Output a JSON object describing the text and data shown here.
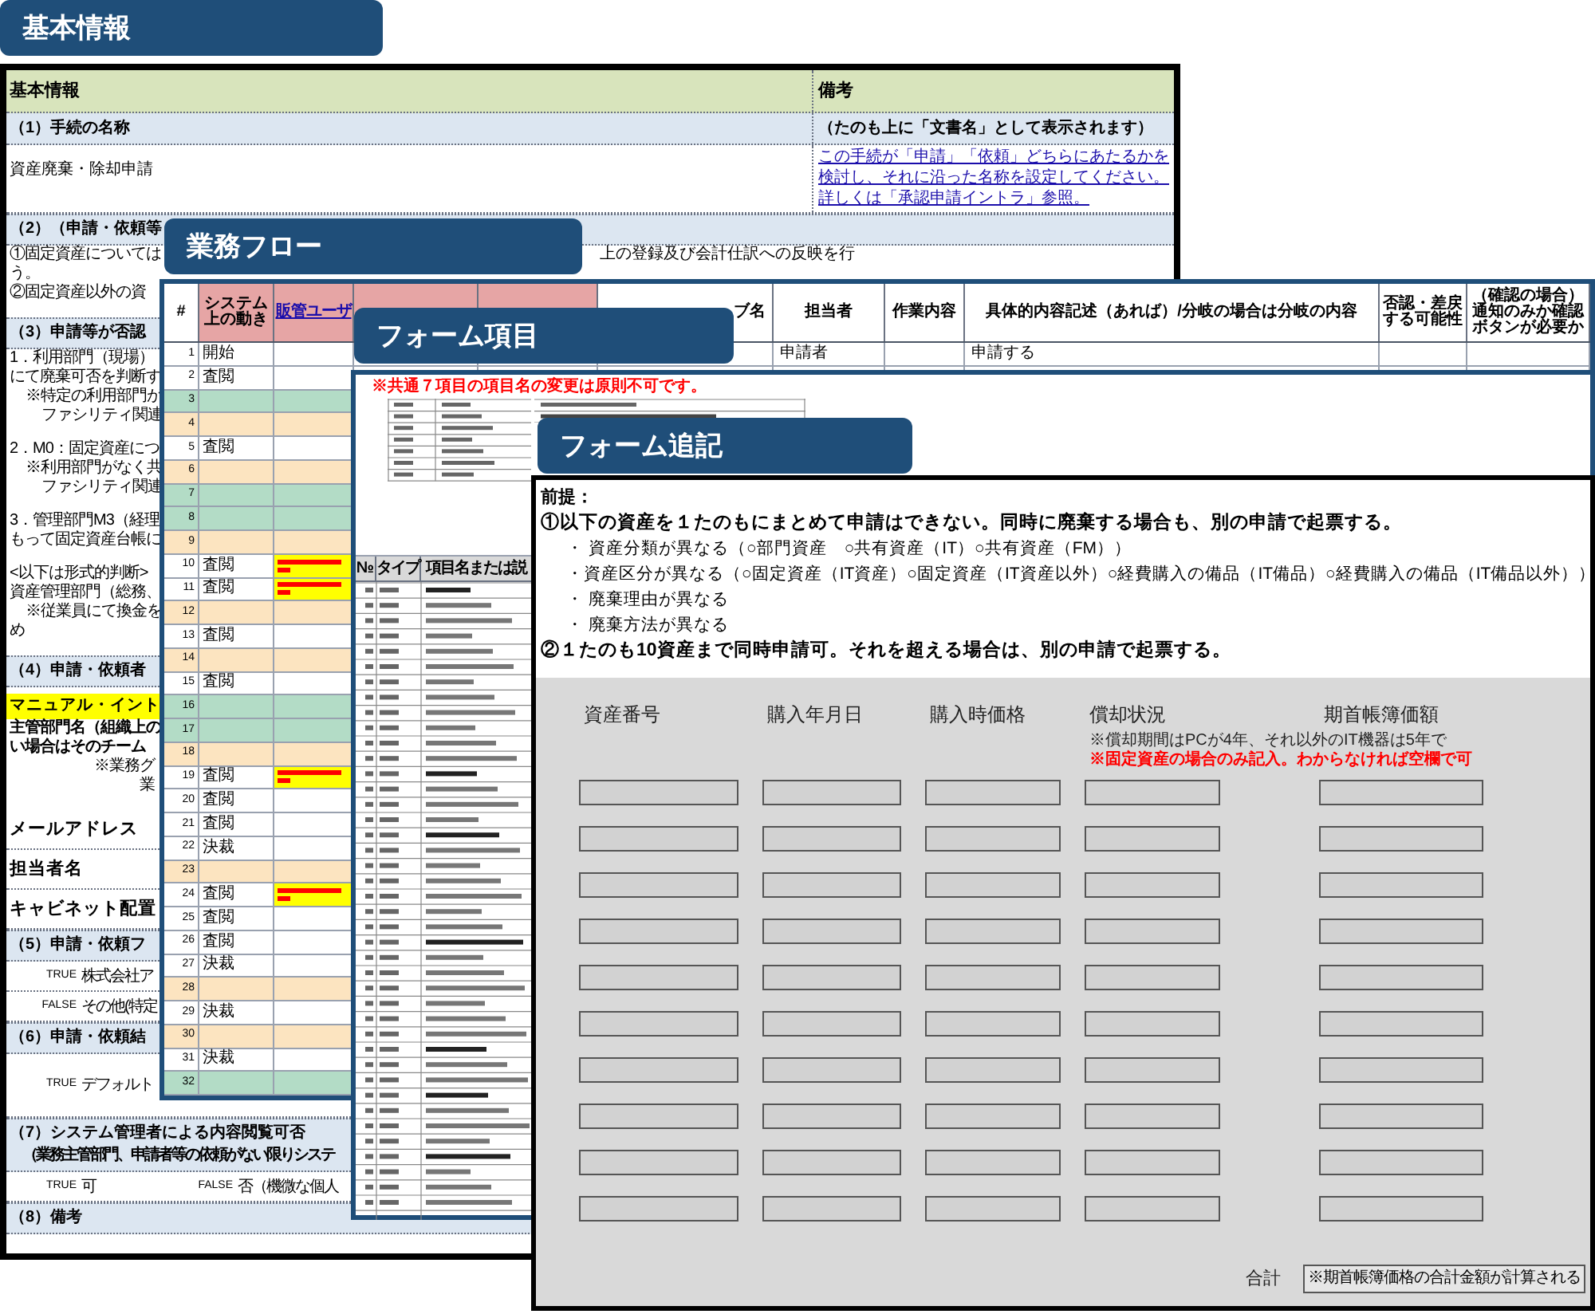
{
  "basic_info": {
    "tab": "基本情報",
    "header": {
      "left": "基本情報",
      "right": "備考"
    },
    "name_section": {
      "title": "（1）手続の名称",
      "note": "（たのも上に「文書名」として表示されます）",
      "value": "資産廃棄・除却申請",
      "help_link": "この手続が「申請」「依頼」どちらにあたるかを検討し、それに沿った名称を設定してください。詳しくは「承認申請イントラ」参照。"
    },
    "blocks": [
      {
        "kind": "band",
        "lines": [
          "（2）（申請・依頼等"
        ]
      },
      {
        "kind": "para",
        "lines": [
          {
            "kind": "plain",
            "text": "①固定資産については",
            "tail": "上の登録及び会計仕訳への反映を行"
          },
          {
            "kind": "plain",
            "text": "う。"
          },
          {
            "kind": "plain",
            "text": "②固定資産以外の資"
          }
        ]
      },
      {
        "kind": "band",
        "lines": [
          "（3）申請等が否認"
        ]
      },
      {
        "kind": "para",
        "lines": [
          {
            "kind": "plain",
            "text": "1．利用部門（現場）"
          },
          {
            "kind": "plain",
            "text": "にて廃棄可否を判断す"
          },
          {
            "kind": "note",
            "text": "※特定の利用部門が"
          },
          {
            "kind": "sub",
            "text": "ファシリティ関連"
          }
        ]
      },
      {
        "kind": "para",
        "lines": [
          {
            "kind": "plain",
            "text": "2．M0：固定資産につ"
          },
          {
            "kind": "note",
            "text": "※利用部門がなく共"
          },
          {
            "kind": "sub",
            "text": "ファシリティ関連"
          }
        ]
      },
      {
        "kind": "para",
        "lines": [
          {
            "kind": "plain",
            "text": "3．管理部門M3（経理"
          },
          {
            "kind": "plain",
            "text": "もって固定資産台帳に"
          }
        ]
      },
      {
        "kind": "para",
        "lines": [
          {
            "kind": "plain",
            "text": "<以下は形式的判断>"
          },
          {
            "kind": "plain",
            "text": "資産管理部門（総務、"
          },
          {
            "kind": "note",
            "text": "※従業員にて換金を"
          },
          {
            "kind": "plain",
            "text": "め"
          }
        ]
      },
      {
        "kind": "band",
        "lines": [
          "（4）申請・依頼者"
        ]
      },
      {
        "kind": "highlight",
        "text": "マニュアル・イント"
      },
      {
        "kind": "para",
        "lines": [
          {
            "kind": "bold",
            "text": "主管部門名（組織上の"
          },
          {
            "kind": "bold",
            "text": "い場合はそのチーム"
          },
          {
            "kind": "right",
            "text": "※業務グ"
          },
          {
            "kind": "right",
            "text": "業"
          }
        ]
      },
      {
        "kind": "label",
        "text": "メールアドレス"
      },
      {
        "kind": "label",
        "text": "担当者名"
      },
      {
        "kind": "label",
        "text": "キャビネット配置"
      },
      {
        "kind": "band",
        "lines": [
          "（5）申請・依頼フ"
        ]
      },
      {
        "kind": "options",
        "items": [
          {
            "flag": "TRUE",
            "text": "株式会社ア"
          }
        ]
      },
      {
        "kind": "options",
        "items": [
          {
            "flag": "FALSE",
            "text": "その他(特定"
          }
        ]
      },
      {
        "kind": "band",
        "lines": [
          "（6）申請・依頼結"
        ]
      },
      {
        "kind": "options_tall",
        "items": [
          {
            "flag": "TRUE",
            "text": "デフォルト"
          }
        ]
      }
    ],
    "footer_blocks": [
      {
        "kind": "band",
        "lines": [
          "（7）システム管理者による内容閲覧可否",
          "（業務主管部門、申請者等の依頼がない限りシステ"
        ]
      },
      {
        "kind": "options",
        "items": [
          {
            "flag": "TRUE",
            "text": "可"
          },
          {
            "flag": "FALSE",
            "text": "否（機微な個人"
          }
        ]
      },
      {
        "kind": "band",
        "lines": [
          "（8）備考"
        ]
      }
    ]
  },
  "business_flow": {
    "tab": "業務フロー",
    "columns": [
      {
        "kind": "plain",
        "text": "#"
      },
      {
        "kind": "pink",
        "text": "システム上の動き"
      },
      {
        "kind": "link",
        "text": "販管ユーザ"
      },
      {
        "kind": "pink"
      },
      {
        "kind": "pink"
      },
      {
        "kind": "plain",
        "text": "ブ名"
      },
      {
        "kind": "plain",
        "text": "担当者"
      },
      {
        "kind": "plain",
        "text": "作業内容"
      },
      {
        "kind": "plain",
        "text": "具体的内容記述（あれば）/分岐の場合は分岐の内容"
      },
      {
        "kind": "plain",
        "text": "否認・差戻する可能性"
      },
      {
        "kind": "plain",
        "text": "（確認の場合）通知のみか確認ボタンが必要か"
      }
    ],
    "rows": [
      {
        "no": "1",
        "action": "開始",
        "color": "#ffffff",
        "flagged": false,
        "assignee": "申請者",
        "detail": "申請する"
      },
      {
        "no": "2",
        "action": "査閲",
        "color": "#ffffff",
        "flagged": false
      },
      {
        "no": "3",
        "color": "#b3dcc6",
        "flagged": false
      },
      {
        "no": "4",
        "color": "#fce4c0",
        "flagged": false
      },
      {
        "no": "5",
        "action": "査閲",
        "color": "#ffffff",
        "flagged": false
      },
      {
        "no": "6",
        "color": "#fce4c0",
        "flagged": false
      },
      {
        "no": "7",
        "color": "#b3dcc6",
        "flagged": false
      },
      {
        "no": "8",
        "color": "#b3dcc6",
        "flagged": false
      },
      {
        "no": "9",
        "color": "#fce4c0",
        "flagged": false
      },
      {
        "no": "10",
        "action": "査閲",
        "color": "#ffffff",
        "flagged": true
      },
      {
        "no": "11",
        "action": "査閲",
        "color": "#ffffff",
        "flagged": true
      },
      {
        "no": "12",
        "color": "#fce4c0",
        "flagged": false
      },
      {
        "no": "13",
        "action": "査閲",
        "color": "#ffffff",
        "flagged": false
      },
      {
        "no": "14",
        "color": "#fce4c0",
        "flagged": false
      },
      {
        "no": "15",
        "action": "査閲",
        "color": "#ffffff",
        "flagged": false
      },
      {
        "no": "16",
        "color": "#b3dcc6",
        "flagged": false
      },
      {
        "no": "17",
        "color": "#b3dcc6",
        "flagged": false
      },
      {
        "no": "18",
        "color": "#fce4c0",
        "flagged": false
      },
      {
        "no": "19",
        "action": "査閲",
        "color": "#ffffff",
        "flagged": true
      },
      {
        "no": "20",
        "action": "査閲",
        "color": "#ffffff",
        "flagged": false
      },
      {
        "no": "21",
        "action": "査閲",
        "color": "#ffffff",
        "flagged": false
      },
      {
        "no": "22",
        "action": "決裁",
        "color": "#ffffff",
        "flagged": false
      },
      {
        "no": "23",
        "color": "#fce4c0",
        "flagged": false
      },
      {
        "no": "24",
        "action": "査閲",
        "color": "#ffffff",
        "flagged": true
      },
      {
        "no": "25",
        "action": "査閲",
        "color": "#ffffff",
        "flagged": false
      },
      {
        "no": "26",
        "action": "査閲",
        "color": "#ffffff",
        "flagged": false
      },
      {
        "no": "27",
        "action": "決裁",
        "color": "#ffffff",
        "flagged": false
      },
      {
        "no": "28",
        "color": "#fce4c0",
        "flagged": false
      },
      {
        "no": "29",
        "action": "決裁",
        "color": "#ffffff",
        "flagged": false
      },
      {
        "no": "30",
        "color": "#fce4c0",
        "flagged": false
      },
      {
        "no": "31",
        "action": "決裁",
        "color": "#ffffff",
        "flagged": false
      },
      {
        "no": "32",
        "color": "#b3dcc6",
        "flagged": false
      }
    ]
  },
  "form_items": {
    "tab": "フォーム項目",
    "note": "※共通７項目の項目名の変更は原則不可です。",
    "columns": [
      "№",
      "タイプ",
      "項目名または説"
    ]
  },
  "form_addendum": {
    "tab": "フォーム追記",
    "premise_title": "前提：",
    "items": [
      {
        "kind": "main",
        "text": "①以下の資産を１たのもにまとめて申請はできない。同時に廃棄する場合も、別の申請で起票する。"
      },
      {
        "kind": "bullet",
        "marker": "・",
        "text": "資産分類が異なる（○部門資産　○共有資産（IT）○共有資産（FM））"
      },
      {
        "kind": "bullet",
        "marker": "・",
        "text": "資産区分が異なる（○固定資産（IT資産）○固定資産（IT資産以外）○経費購入の備品（IT備品）○経費購入の備品（IT備品以外））"
      },
      {
        "kind": "bullet",
        "marker": "・",
        "text": "廃棄理由が異なる"
      },
      {
        "kind": "bullet",
        "marker": "・",
        "text": "廃棄方法が異なる"
      },
      {
        "kind": "main",
        "text": "②１たのも10資産まで同時申請可。それを超える場合は、別の申請で起票する。"
      }
    ],
    "columns": [
      "資産番号",
      "購入年月日",
      "購入時価格",
      "償却状況",
      "期首帳簿価額"
    ],
    "notes": [
      {
        "kind": "plain",
        "text": "※償却期間はPCが4年、それ以外のIT機器は5年で"
      },
      {
        "kind": "warning",
        "text": "※固定資産の場合のみ記入。わからなければ空欄で可"
      }
    ],
    "total": {
      "label": "合計",
      "value": "※期首帳簿価格の合計金額が計算される"
    }
  }
}
